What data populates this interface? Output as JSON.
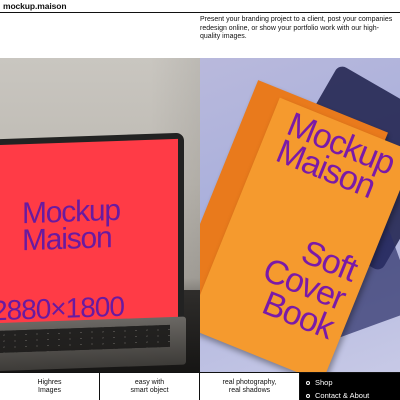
{
  "header": {
    "logo": "mockup.maison",
    "tagline": "Present your branding project to a client, post your companies redesign online, or show your portfolio work with our high-quality images."
  },
  "hero": {
    "laptop_mockup": {
      "line1": "Mockup",
      "line2": "Maison",
      "resolution": "2880×1800"
    },
    "book_mockup": {
      "line1": "Mockup",
      "line2": "Maison",
      "sub1": "Soft",
      "sub2": "Cover",
      "sub3": "Book"
    }
  },
  "features": [
    {
      "label": "Highres\nImages"
    },
    {
      "label": "easy with\nsmart object"
    },
    {
      "label": "real photography,\nreal shadows"
    }
  ],
  "nav": {
    "items": [
      {
        "label": "Shop"
      },
      {
        "label": "Contact & About"
      }
    ]
  },
  "colors": {
    "screen": "#ff3b46",
    "book": "#f59a2e",
    "mockup_text": "#6a1aa0"
  }
}
